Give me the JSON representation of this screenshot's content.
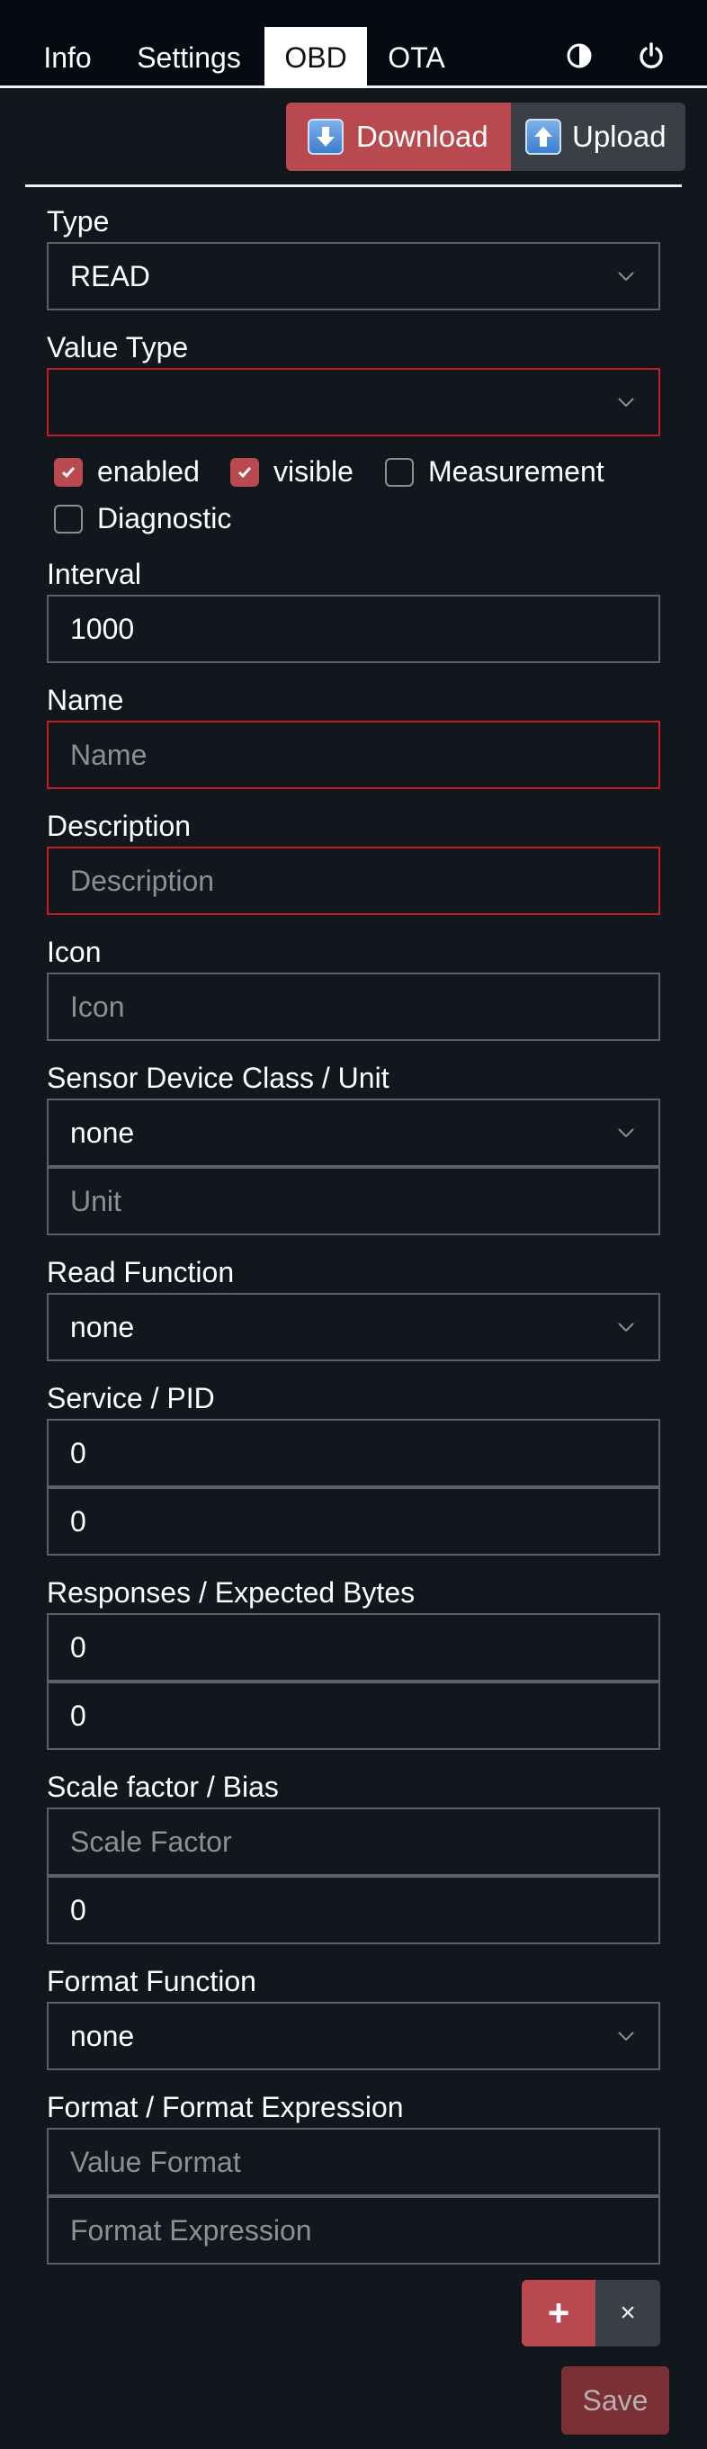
{
  "nav": {
    "tabs": [
      {
        "label": "Info"
      },
      {
        "label": "Settings"
      },
      {
        "label": "OBD"
      },
      {
        "label": "OTA"
      }
    ],
    "active_tab": "OBD",
    "icons": [
      "theme-toggle-icon",
      "power-icon"
    ]
  },
  "toolbar": {
    "download_label": "Download",
    "upload_label": "Upload"
  },
  "form": {
    "type": {
      "label": "Type",
      "value": "READ"
    },
    "value_type": {
      "label": "Value Type",
      "value": ""
    },
    "checks": {
      "enabled": {
        "label": "enabled",
        "checked": true
      },
      "visible": {
        "label": "visible",
        "checked": true
      },
      "measurement": {
        "label": "Measurement",
        "checked": false
      },
      "diagnostic": {
        "label": "Diagnostic",
        "checked": false
      }
    },
    "interval": {
      "label": "Interval",
      "value": "1000"
    },
    "name": {
      "label": "Name",
      "placeholder": "Name"
    },
    "description": {
      "label": "Description",
      "placeholder": "Description"
    },
    "icon": {
      "label": "Icon",
      "placeholder": "Icon"
    },
    "sensor": {
      "label": "Sensor Device Class / Unit",
      "device_class": "none",
      "unit_placeholder": "Unit"
    },
    "read_function": {
      "label": "Read Function",
      "value": "none"
    },
    "service_pid": {
      "label": "Service / PID",
      "service": "0",
      "pid": "0"
    },
    "responses": {
      "label": "Responses / Expected Bytes",
      "responses": "0",
      "expected_bytes": "0"
    },
    "scale": {
      "label": "Scale factor / Bias",
      "scale_placeholder": "Scale Factor",
      "bias": "0"
    },
    "format_function": {
      "label": "Format Function",
      "value": "none"
    },
    "format": {
      "label": "Format / Format Expression",
      "format_placeholder": "Value Format",
      "expression_placeholder": "Format Expression"
    }
  },
  "actions": {
    "add_label": "+",
    "delete_label": "×",
    "save_label": "Save"
  },
  "colors": {
    "background": "#12171d",
    "accent": "#b84a4f",
    "invalid_border": "#c41c22",
    "nav_bg": "#050a12"
  }
}
